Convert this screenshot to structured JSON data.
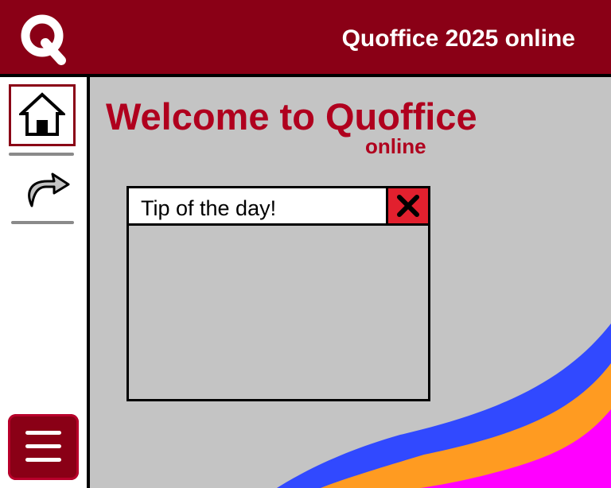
{
  "header": {
    "logo_letter": "Q",
    "title": "Quoffice 2025 online"
  },
  "sidebar": {
    "items": [
      {
        "icon": "home-icon",
        "active": true
      },
      {
        "icon": "forward-arrow-icon",
        "active": false
      }
    ],
    "menu_icon": "hamburger-menu-icon"
  },
  "main": {
    "welcome_title": "Welcome to Quoffice",
    "welcome_subtitle": "online"
  },
  "dialog": {
    "title": "Tip of the day!",
    "close_icon": "close-x-icon",
    "body": ""
  },
  "colors": {
    "brand": "#8a0016",
    "title_red": "#b0001e",
    "background": "#c4c4c4",
    "close_red": "#e2202e",
    "wave_blue": "#3149ff",
    "wave_orange": "#ff9b21",
    "wave_magenta": "#ff00ff"
  }
}
